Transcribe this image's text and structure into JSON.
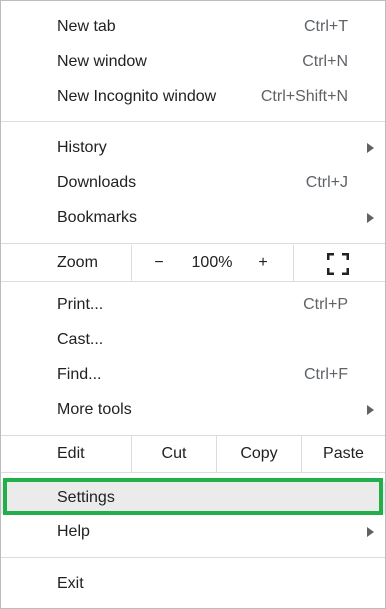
{
  "menu": {
    "new_tab": {
      "label": "New tab",
      "shortcut": "Ctrl+T"
    },
    "new_window": {
      "label": "New window",
      "shortcut": "Ctrl+N"
    },
    "new_incognito": {
      "label": "New Incognito window",
      "shortcut": "Ctrl+Shift+N"
    },
    "history": {
      "label": "History"
    },
    "downloads": {
      "label": "Downloads",
      "shortcut": "Ctrl+J"
    },
    "bookmarks": {
      "label": "Bookmarks"
    },
    "zoom": {
      "label": "Zoom",
      "decrease": "−",
      "level": "100%",
      "increase": "+",
      "fullscreen_icon": "fullscreen-icon"
    },
    "print": {
      "label": "Print...",
      "shortcut": "Ctrl+P"
    },
    "cast": {
      "label": "Cast..."
    },
    "find": {
      "label": "Find...",
      "shortcut": "Ctrl+F"
    },
    "more_tools": {
      "label": "More tools"
    },
    "edit": {
      "label": "Edit",
      "cut": "Cut",
      "copy": "Copy",
      "paste": "Paste"
    },
    "settings": {
      "label": "Settings"
    },
    "help": {
      "label": "Help"
    },
    "exit": {
      "label": "Exit"
    }
  },
  "colors": {
    "highlight_border": "#22ae4b",
    "hover_background": "#ebebeb"
  }
}
